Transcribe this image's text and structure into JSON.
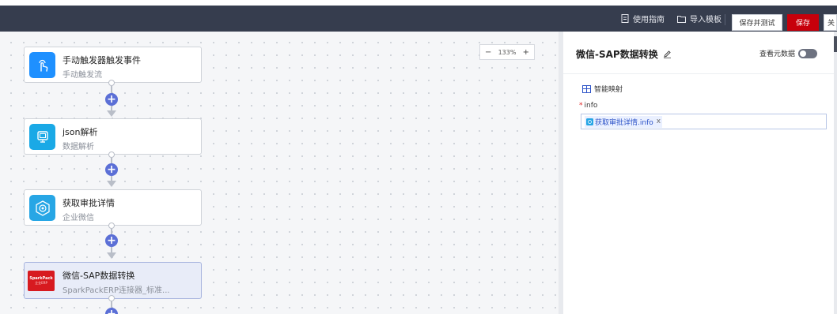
{
  "toolbar": {
    "guide_label": "使用指南",
    "import_label": "导入模板",
    "save_test_label": "保存并测试",
    "save_label": "保存",
    "partial_label": "关",
    "accent_color": "#c7000b",
    "bar_color": "#363d4e"
  },
  "canvas": {
    "zoom_label": "133%",
    "zoom_out": "−",
    "zoom_in": "+",
    "nodes": [
      {
        "title": "手动触发器触发事件",
        "subtitle": "手动触发流",
        "icon": "hand-touch-icon",
        "color": "#1e90ff"
      },
      {
        "title": "json解析",
        "subtitle": "数据解析",
        "icon": "data-parse-icon",
        "color": "#1aa9e6"
      },
      {
        "title": "获取审批详情",
        "subtitle": "企业微信",
        "icon": "wecom-icon",
        "color": "#27a6e5"
      },
      {
        "title": "微信-SAP数据转换",
        "subtitle": "SparkPackERP连接器_标准...",
        "icon": "sparkpack-logo",
        "color": "#d71a20",
        "logo_text": "SparkPack",
        "logo_sub": "企业ERP"
      }
    ]
  },
  "panel": {
    "title": "微信-SAP数据转换",
    "meta_label": "查看元数据",
    "mapping_label": "智能映射",
    "field_label": "info",
    "field_required": "*",
    "field_value": "获取审批详情.info",
    "chip_remove": "x"
  }
}
